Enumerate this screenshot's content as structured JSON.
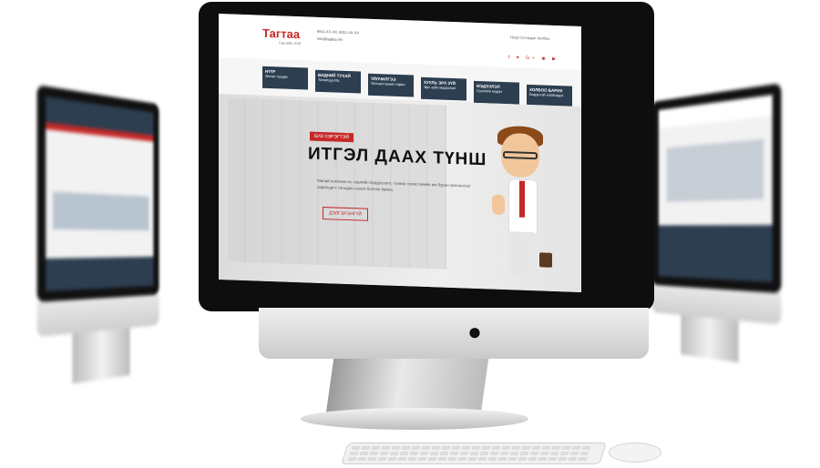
{
  "site": {
    "logo": "Тагтаа",
    "logo_sub": "Гаалийн ХХК",
    "contact_lines": [
      "9911-XX-XX, 8811-XX-XX",
      "info@tagtaa.mn"
    ],
    "top_links": "Нүүр  Сэтгэгдэл  Холбоо",
    "social_icons": "f ♥ G+ ◉ ▶",
    "nav": [
      {
        "title": "НҮҮР",
        "sub": "Эхлэл хуудас"
      },
      {
        "title": "БИДНИЙ ТУХАЙ",
        "sub": "Танилцуулга"
      },
      {
        "title": "ҮЙЛЧИЛГЭЭ",
        "sub": "Үйлчилгээний төрөл"
      },
      {
        "title": "ХУУЛЬ ЭРХ ЗҮЙ",
        "sub": "Эрх зүйн мэдээлэл"
      },
      {
        "title": "МЭДЭЭЛЭЛ",
        "sub": "Сүүлийн мэдээ"
      },
      {
        "title": "ХОЛБОО БАРИХ",
        "sub": "Бидэнтэй холбогдох"
      }
    ],
    "hero": {
      "badge": "БИЗ ХЭРЭГТЭЙ",
      "title": "ИТГЭЛ ДААХ ТҮНШ",
      "description": "Манай компани нь гаалийн бүрдүүлэлт, тээвэр логистикийн иж бүрэн үйлчилгээг харилцагч таньдаа санал болгож байна.",
      "cta": "ДЭЛГЭРЭНГҮЙ"
    }
  },
  "colors": {
    "accent": "#c62828",
    "nav": "#2c3e50"
  }
}
